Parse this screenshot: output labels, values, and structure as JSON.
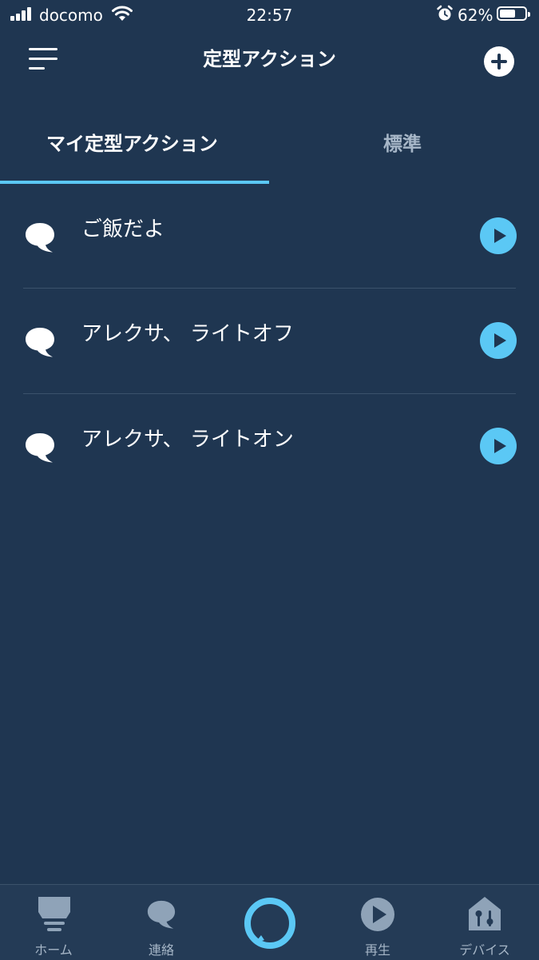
{
  "status_bar": {
    "carrier": "docomo",
    "time": "22:57",
    "battery_percent": "62%"
  },
  "header": {
    "title": "定型アクション"
  },
  "tabs": [
    {
      "label": "マイ定型アクション",
      "active": true
    },
    {
      "label": "標準",
      "active": false
    }
  ],
  "routines": [
    {
      "label": "ご飯だよ"
    },
    {
      "label": "アレクサ、 ライトオフ"
    },
    {
      "label": "アレクサ、 ライトオン"
    }
  ],
  "bottom_nav": {
    "home": "ホーム",
    "communicate": "連絡",
    "play": "再生",
    "devices": "デバイス"
  },
  "colors": {
    "background": "#1f3651",
    "accent": "#5bc8f5",
    "inactive_text": "#a6b6c7"
  }
}
